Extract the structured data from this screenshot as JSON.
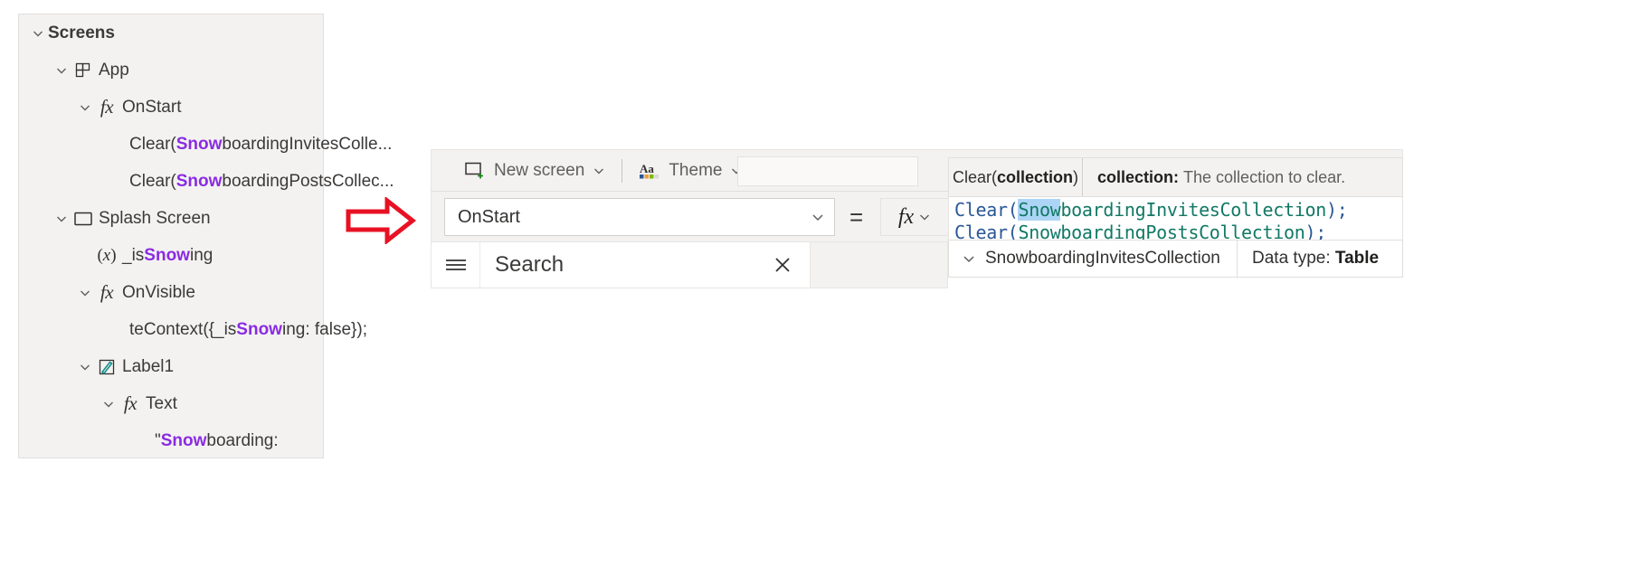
{
  "tree_panel": {
    "search_term": "Snow",
    "highlight_color": "#8a2be2",
    "rows": [
      {
        "label": "Screens",
        "icon": "none",
        "chevron": "chevron-down-icon",
        "indent": 0,
        "bold": true,
        "pre": "",
        "hl": "",
        "post": "Screens"
      },
      {
        "label": "App",
        "icon": "app-grid-icon",
        "chevron": "chevron-down-icon",
        "indent": 1,
        "bold": false,
        "pre": "",
        "hl": "",
        "post": "App"
      },
      {
        "label": "OnStart",
        "icon": "fx-icon",
        "chevron": "chevron-down-icon",
        "indent": 2,
        "bold": false,
        "pre": "",
        "hl": "",
        "post": "OnStart"
      },
      {
        "label": "Clear(SnowboardingInvitesColle...",
        "icon": "none",
        "chevron": "none",
        "indent": 4,
        "bold": false,
        "pre": "Clear(",
        "hl": "Snow",
        "post": "boardingInvitesColle..."
      },
      {
        "label": "Clear(SnowboardingPostsCollec...",
        "icon": "none",
        "chevron": "none",
        "indent": 4,
        "bold": false,
        "pre": "Clear(",
        "hl": "Snow",
        "post": "boardingPostsCollec..."
      },
      {
        "label": "Splash Screen",
        "icon": "screen-rect-icon",
        "chevron": "chevron-down-icon",
        "indent": 1,
        "bold": false,
        "pre": "",
        "hl": "",
        "post": "Splash Screen"
      },
      {
        "label": "_isSnowing",
        "icon": "variable-x-icon",
        "chevron": "none",
        "indent": 2,
        "bold": false,
        "pre": "_is",
        "hl": "Snow",
        "post": "ing"
      },
      {
        "label": "OnVisible",
        "icon": "fx-icon",
        "chevron": "chevron-down-icon",
        "indent": 2,
        "bold": false,
        "pre": "",
        "hl": "",
        "post": "OnVisible"
      },
      {
        "label": "teContext({_isSnowing: false});",
        "icon": "none",
        "chevron": "none",
        "indent": 4,
        "bold": false,
        "pre": "teContext({_is",
        "hl": "Snow",
        "post": "ing: false});"
      },
      {
        "label": "Label1",
        "icon": "label-pencil-icon",
        "chevron": "chevron-down-icon",
        "indent": 2,
        "bold": false,
        "pre": "",
        "hl": "",
        "post": "Label1"
      },
      {
        "label": "Text",
        "icon": "fx-icon",
        "chevron": "chevron-down-icon",
        "indent": 3,
        "bold": false,
        "pre": "",
        "hl": "",
        "post": "Text"
      },
      {
        "label": "\"Snowboarding:",
        "icon": "none",
        "chevron": "none",
        "indent": 5,
        "bold": false,
        "pre": "\"",
        "hl": "Snow",
        "post": "boarding:"
      }
    ]
  },
  "annotation": {
    "arrow": "right-arrow-annotation",
    "arrow_color": "#e81123"
  },
  "command_bar": {
    "new_screen_label": "New screen",
    "new_screen_icon": "new-screen-icon",
    "theme_label": "Theme",
    "theme_icon": "theme-aa-icon",
    "chevron_icon": "chevron-down-icon"
  },
  "formula_bar": {
    "property_selected": "OnStart",
    "equals_sign": "=",
    "fx_glyph": "fx",
    "code_lines": [
      {
        "fn": "Clear",
        "open": "(",
        "sel": "Snow",
        "ident": "boardingInvitesCollection",
        "close": ")",
        "semi": ";"
      },
      {
        "fn": "Clear",
        "open": "(",
        "sel": "",
        "ident": "SnowboardingPostsCollection",
        "close": ")",
        "semi": ";"
      }
    ]
  },
  "intellisense_tooltip": {
    "signature_prefix": "Clear(",
    "signature_bold": "collection",
    "signature_suffix": ")",
    "description_bold": "collection:",
    "description_text": "The collection to clear."
  },
  "suggestion": {
    "name": "SnowboardingInvitesCollection",
    "chevron_icon": "chevron-down-icon",
    "data_type_label": "Data type:",
    "data_type_value": "Table"
  },
  "search_bar": {
    "hamburger_icon": "hamburger-icon",
    "value": "Search",
    "placeholder": "Search",
    "clear_icon": "close-x-icon"
  }
}
